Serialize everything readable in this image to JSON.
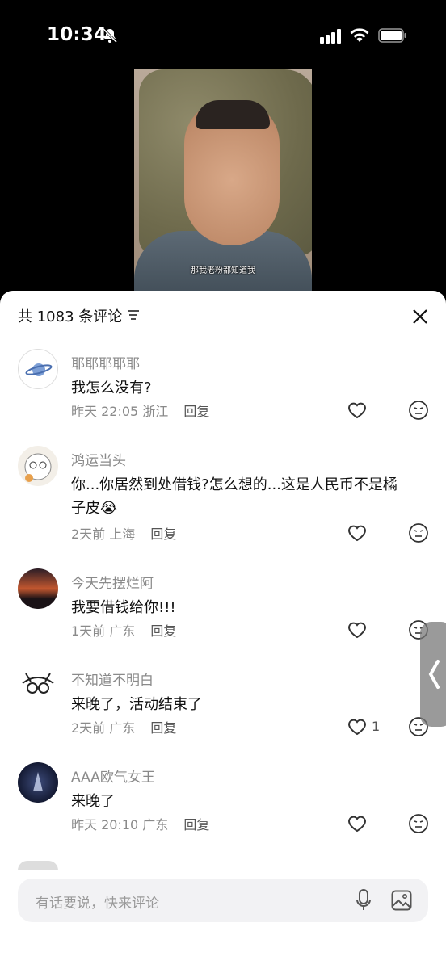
{
  "status_bar": {
    "time": "10:34"
  },
  "video": {
    "caption": "那我老粉都知道我"
  },
  "comments_header": {
    "count_label": "共 1083 条评论"
  },
  "comments": [
    {
      "username": "耶耶耶耶耶",
      "text": "我怎么没有?",
      "time": "昨天 22:05",
      "location": "浙江",
      "reply": "回复",
      "likes": ""
    },
    {
      "username": "鸿运当头",
      "text": "你...你居然到处借钱?怎么想的...这是人民币不是橘子皮😭",
      "time": "2天前",
      "location": "上海",
      "reply": "回复",
      "likes": ""
    },
    {
      "username": "今天先摆烂阿",
      "text": "我要借钱给你!!!",
      "time": "1天前",
      "location": "广东",
      "reply": "回复",
      "likes": ""
    },
    {
      "username": "不知道不明白",
      "text": "来晚了，活动结束了",
      "time": "2天前",
      "location": "广东",
      "reply": "回复",
      "likes": "1"
    },
    {
      "username": "AAA欧气女王",
      "text": "来晚了",
      "time": "昨天 20:10",
      "location": "广东",
      "reply": "回复",
      "likes": ""
    }
  ],
  "input": {
    "placeholder": "有话要说，快来评论"
  }
}
